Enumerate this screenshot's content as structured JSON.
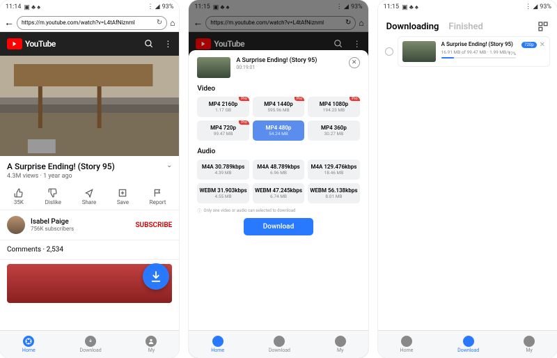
{
  "status": {
    "time1": "11:14",
    "time2": "11:15",
    "time3": "11:15",
    "battery": "93%"
  },
  "url": "https://m.youtube.com/watch?v=L4tAfNiznml",
  "youtube_label": "YouTube",
  "video": {
    "title": "A Surprise Ending! (Story 95)",
    "meta": "4.3M views · 1 year ago",
    "duration": "00:19:01"
  },
  "actions": {
    "like": "35K",
    "dislike": "Dislike",
    "share": "Share",
    "save": "Save",
    "report": "Report"
  },
  "channel": {
    "name": "Isabel Paige",
    "subs": "756K subscribers",
    "subscribe": "SUBSCRIBE"
  },
  "comments": "Comments · 2,534",
  "nav": {
    "home": "Home",
    "download": "Download",
    "my": "My"
  },
  "sheet": {
    "video_label": "Video",
    "audio_label": "Audio",
    "pro": "Pro",
    "hint": "Only one video or audio can selected to download",
    "download_btn": "Download",
    "video_opts": [
      {
        "name": "MP4 2160p",
        "size": "1.17 GB",
        "pro": true
      },
      {
        "name": "MP4 1440p",
        "size": "595.96 MB",
        "pro": true
      },
      {
        "name": "MP4 1080p",
        "size": "194.23 MB",
        "pro": true
      },
      {
        "name": "MP4 720p",
        "size": "99.47 MB",
        "pro": true
      },
      {
        "name": "MP4 480p",
        "size": "54.24 MB",
        "pro": false,
        "selected": true
      },
      {
        "name": "MP4 360p",
        "size": "30.27 MB",
        "pro": false
      }
    ],
    "audio_opts": [
      {
        "name": "M4A 30.789kbps",
        "size": "4.39 MB"
      },
      {
        "name": "M4A 48.789kbps",
        "size": "6.96 MB"
      },
      {
        "name": "M4A 129.476kbps",
        "size": "18.46 MB"
      },
      {
        "name": "WEBM 31.903kbps",
        "size": "4.55 MB"
      },
      {
        "name": "WEBM 47.245kbps",
        "size": "6.74 MB"
      },
      {
        "name": "WEBM 56.138kbps",
        "size": "8.01 MB"
      }
    ]
  },
  "downloads": {
    "tab_downloading": "Downloading",
    "tab_finished": "Finished",
    "item": {
      "title": "A Surprise Ending! (Story 95)",
      "stats": "16.91 MB of 99.47 MB · 1.99 MB/s",
      "badge": "720p",
      "pct": "17%"
    }
  }
}
